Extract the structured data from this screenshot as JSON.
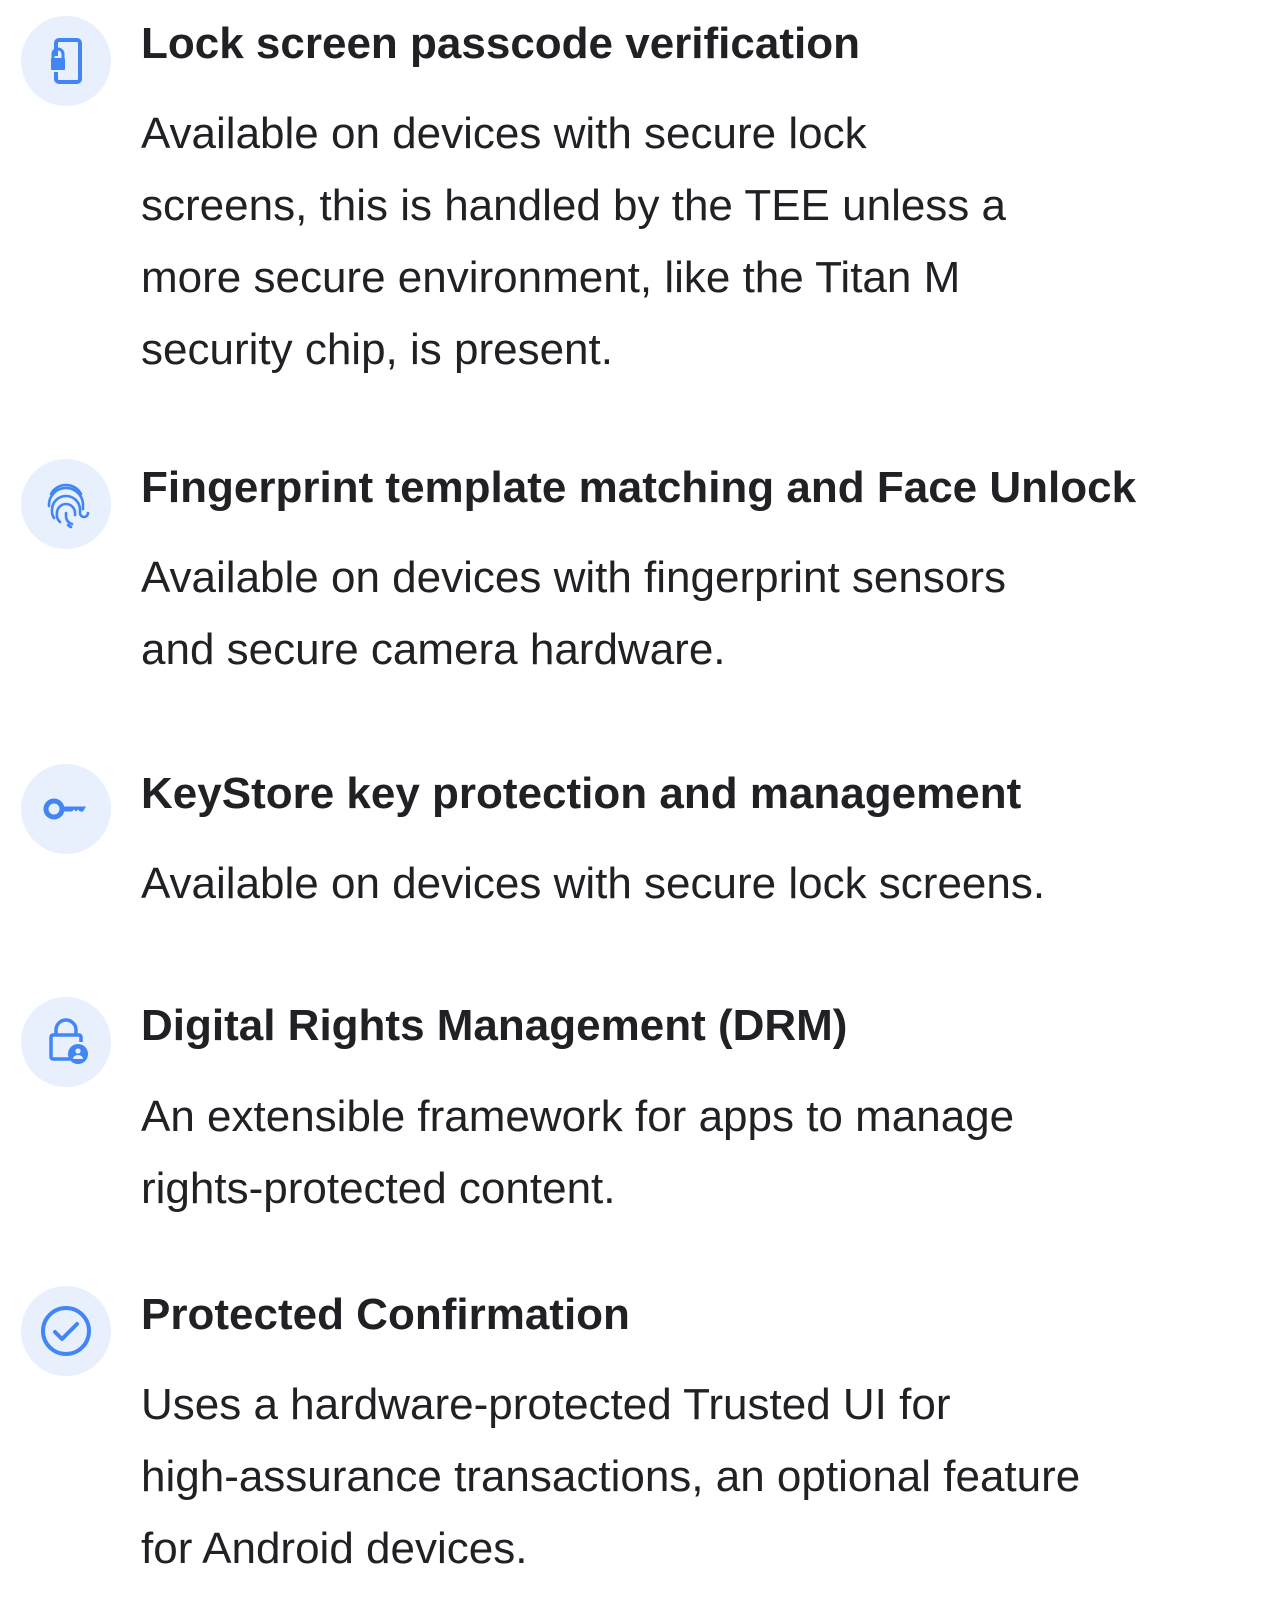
{
  "accent_color": "#4285f4",
  "icon_background": "#e8f0fe",
  "features": [
    {
      "icon": "phone-lock-icon",
      "title": "Lock screen passcode verification",
      "description_lines": [
        "Available on devices with secure lock",
        "screens, this is handled by the TEE unless a",
        "more secure environment, like the Titan M",
        "security chip, is present."
      ]
    },
    {
      "icon": "fingerprint-icon",
      "title": "Fingerprint template matching and Face Unlock",
      "description_lines": [
        "Available on devices with fingerprint sensors",
        "and secure camera hardware."
      ]
    },
    {
      "icon": "key-icon",
      "title": "KeyStore key protection and management",
      "description_lines": [
        "Available on devices with secure lock screens."
      ]
    },
    {
      "icon": "lock-person-icon",
      "title": "Digital Rights Management (DRM)",
      "description_lines": [
        "An extensible framework for apps to manage",
        "rights-protected content."
      ]
    },
    {
      "icon": "check-circle-icon",
      "title": "Protected Confirmation",
      "description_lines": [
        "Uses a hardware-protected Trusted UI for",
        "high-assurance transactions, an optional feature",
        "for Android devices."
      ]
    }
  ]
}
